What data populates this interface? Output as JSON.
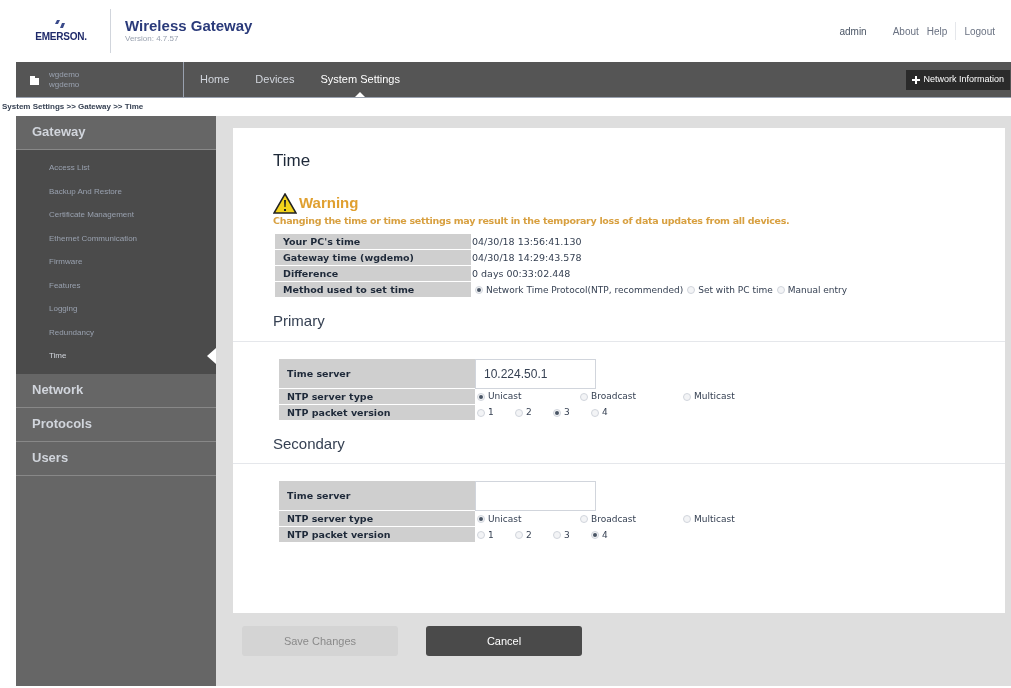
{
  "header": {
    "brand": "EMERSON.",
    "product": "Wireless Gateway",
    "version": "Version: 4.7.57",
    "user": "admin",
    "links": [
      "About",
      "Help",
      "Logout"
    ]
  },
  "nav": {
    "device_name": "wgdemo",
    "device_sub": "wgdemo",
    "tabs": [
      {
        "label": "Home",
        "selected": false
      },
      {
        "label": "Devices",
        "selected": false
      },
      {
        "label": "System Settings",
        "selected": true
      }
    ],
    "network_button": "Network Information"
  },
  "breadcrumb": "System Settings >> Gateway >> Time",
  "sidebar": [
    {
      "label": "Gateway",
      "expanded": true,
      "children": [
        {
          "label": "Access List",
          "selected": false
        },
        {
          "label": "Backup And Restore",
          "selected": false
        },
        {
          "label": "Certificate Management",
          "selected": false
        },
        {
          "label": "Ethernet Communication",
          "selected": false
        },
        {
          "label": "Firmware",
          "selected": false
        },
        {
          "label": "Features",
          "selected": false
        },
        {
          "label": "Logging",
          "selected": false
        },
        {
          "label": "Redundancy",
          "selected": false
        },
        {
          "label": "Time",
          "selected": true
        }
      ]
    },
    {
      "label": "Network",
      "expanded": false
    },
    {
      "label": "Protocols",
      "expanded": false
    },
    {
      "label": "Users",
      "expanded": false
    }
  ],
  "page": {
    "title": "Time",
    "warning_title": "Warning",
    "warning_text": "Changing the time or time settings may result in the temporary loss of data updates from all devices.",
    "info": [
      {
        "label": "Your PC's time",
        "value": "04/30/18 13:56:41.130"
      },
      {
        "label": "Gateway time (wgdemo)",
        "value": "04/30/18 14:29:43.578"
      },
      {
        "label": "Difference",
        "value": "0 days 00:33:02.448"
      }
    ],
    "method": {
      "label": "Method used to set time",
      "options": [
        {
          "label": "Network Time Protocol(NTP, recommended)",
          "selected": true
        },
        {
          "label": "Set with PC time",
          "selected": false
        },
        {
          "label": "Manual entry",
          "selected": false
        }
      ]
    },
    "servers": [
      {
        "heading": "Primary",
        "time_server_label": "Time server",
        "time_server": "10.224.50.1",
        "type_label": "NTP server type",
        "types": [
          {
            "label": "Unicast",
            "selected": true
          },
          {
            "label": "Broadcast",
            "selected": false
          },
          {
            "label": "Multicast",
            "selected": false
          }
        ],
        "version_label": "NTP packet version",
        "versions": [
          {
            "label": "1",
            "selected": false
          },
          {
            "label": "2",
            "selected": false
          },
          {
            "label": "3",
            "selected": true
          },
          {
            "label": "4",
            "selected": false
          }
        ]
      },
      {
        "heading": "Secondary",
        "time_server_label": "Time server",
        "type_label": "NTP server type",
        "types": [
          {
            "label": "Unicast",
            "selected": true
          },
          {
            "label": "Broadcast",
            "selected": false
          },
          {
            "label": "Multicast",
            "selected": false
          }
        ],
        "version_label": "NTP packet version",
        "versions": [
          {
            "label": "1",
            "selected": false
          },
          {
            "label": "2",
            "selected": false
          },
          {
            "label": "3",
            "selected": false
          },
          {
            "label": "4",
            "selected": true
          }
        ]
      }
    ]
  },
  "buttons": [
    {
      "label": "Save Changes",
      "disabled": true
    },
    {
      "label": "Cancel",
      "disabled": false
    }
  ]
}
